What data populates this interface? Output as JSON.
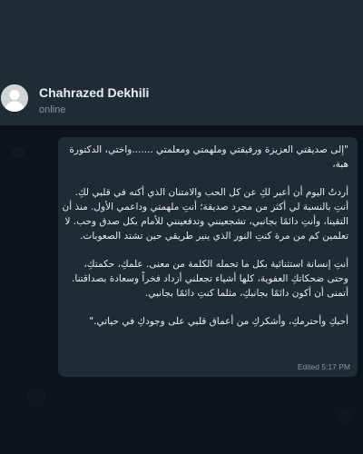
{
  "contact": {
    "name": "Chahrazed Dekhili",
    "status": "online"
  },
  "message": {
    "paragraphs": [
      "\"إلى صديقتي العزيزة ورفيقتي وملهمتي ومعلمتي .......واختي، الدكتورة هبة،",
      "أردتُ اليوم أن أعبر لكِ عن كل الحب والامتنان الذي أكنه في قلبي لكِ. أنتِ بالنسبة لي أكثر من مجرد صديقة؛ أنتِ ملهمتي وداعمي الأول. منذ أن التقينا، وأنتِ دائمًا بجانبي، تشجعينني وتدفعينني للأمام بكل صدق وحب. لا تعلمين كم من مرة كنتِ النور الذي ينير طريقي حين تشتد الصعوبات.",
      "أنتِ إنسانة استثنائية بكل ما تحمله الكلمة من معنى. علمكِ، حكمتكِ، وحتى ضحكاتكِ العفوية، كلها أشياء تجعلني أزداد فخراً وسعادة بصداقتنا. أتمنى أن أكون دائمًا بجانبكِ، مثلما كنتِ دائمًا بجانبي.",
      "أحبكِ وأحترمكِ، وأشكركِ من أعماق قلبي على وجودكِ في حياتي.\""
    ],
    "meta": "Edited 5:17 PM"
  },
  "colors": {
    "background": "#0b141a",
    "header": "#1f2c34",
    "bubble": "#1f2c34",
    "text": "#e9edef",
    "muted": "#8696a0"
  }
}
